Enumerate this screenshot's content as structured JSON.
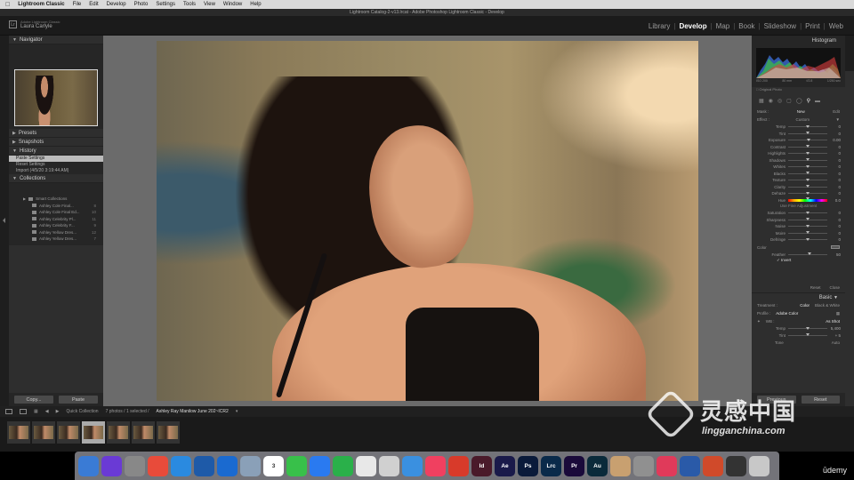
{
  "menubar": {
    "app": "Lightroom Classic",
    "items": [
      "File",
      "Edit",
      "Develop",
      "Photo",
      "Settings",
      "Tools",
      "View",
      "Window",
      "Help"
    ],
    "clock": "Fri 3:06 PM"
  },
  "window_title": "Lightroom Catalog-2-v13.lrcat - Adobe Photoshop Lightroom Classic - Develop",
  "identity": {
    "sub": "Adobe Lightroom Classic",
    "user": "Laura Carlyle"
  },
  "modules": [
    "Library",
    "Develop",
    "Map",
    "Book",
    "Slideshow",
    "Print",
    "Web"
  ],
  "active_module": "Develop",
  "left_panel": {
    "navigator": {
      "label": "Navigator",
      "zoom": [
        "FIT",
        "FILL",
        "1:1",
        "2:1"
      ]
    },
    "presets": "Presets",
    "snapshots": "Snapshots",
    "history": {
      "label": "History",
      "items": [
        "Paste Settings",
        "Reset Settings",
        "Import (4/5/20 3:19:44 AM)"
      ]
    },
    "collections": {
      "label": "Collections",
      "items": [
        {
          "name": "Smart Collections",
          "count": ""
        },
        {
          "name": "Ashley Cole Final...",
          "count": "8"
        },
        {
          "name": "Ashley Cole Final Ed...",
          "count": "10"
        },
        {
          "name": "Ashley Celebrity Pl...",
          "count": "11"
        },
        {
          "name": "Ashley Celebrity F...",
          "count": "9"
        },
        {
          "name": "Ashley Yellow Dres...",
          "count": "12"
        },
        {
          "name": "Ashley Yellow Dres...",
          "count": "7"
        }
      ]
    },
    "copy_btn": "Copy...",
    "paste_btn": "Paste"
  },
  "right_panel": {
    "histogram": "Histogram",
    "hist_info": [
      "ISO 200",
      "80 mm",
      "f/2.8",
      "1/250 sec"
    ],
    "original_photo": "Original Photo",
    "mask_label": "Mask :",
    "mask_new": "New",
    "mask_edit": "Edit",
    "effect": {
      "label": "Effect :",
      "value": "Custom"
    },
    "sliders": [
      {
        "label": "Temp",
        "pos": 0.5,
        "val": "0"
      },
      {
        "label": "Tint",
        "pos": 0.5,
        "val": "0"
      },
      {
        "label": "Exposure",
        "pos": 0.52,
        "val": "0.00"
      },
      {
        "label": "Contrast",
        "pos": 0.5,
        "val": "0"
      },
      {
        "label": "Highlights",
        "pos": 0.5,
        "val": "0"
      },
      {
        "label": "Shadows",
        "pos": 0.5,
        "val": "0"
      },
      {
        "label": "Whites",
        "pos": 0.5,
        "val": "0"
      },
      {
        "label": "Blacks",
        "pos": 0.5,
        "val": "0"
      },
      {
        "label": "Texture",
        "pos": 0.5,
        "val": "0"
      },
      {
        "label": "Clarity",
        "pos": 0.5,
        "val": "0"
      },
      {
        "label": "Dehaze",
        "pos": 0.5,
        "val": "0"
      }
    ],
    "hue": {
      "label": "Hue",
      "pos": 0.5,
      "val": "0.0"
    },
    "hue_sub": "Use Fine Adjustment",
    "sliders2": [
      {
        "label": "Saturation",
        "pos": 0.5,
        "val": "0"
      },
      {
        "label": "Sharpness",
        "pos": 0.5,
        "val": "0"
      },
      {
        "label": "Noise",
        "pos": 0.5,
        "val": "0"
      },
      {
        "label": "Moire",
        "pos": 0.5,
        "val": "0"
      },
      {
        "label": "Defringe",
        "pos": 0.5,
        "val": "0"
      }
    ],
    "color_label": "Color",
    "feather": {
      "label": "Feather",
      "pos": 0.55,
      "val": "50"
    },
    "invert": "Invert",
    "reset": "Reset",
    "close": "Close",
    "basic": "Basic",
    "treatment": {
      "label": "Treatment :",
      "color": "Color",
      "bw": "Black & White"
    },
    "profile": {
      "label": "Profile :",
      "value": "Adobe Color"
    },
    "wb": {
      "label": "WB :",
      "value": "As Shot"
    },
    "sliders3": [
      {
        "label": "Temp",
        "pos": 0.5,
        "val": "5,400"
      },
      {
        "label": "Tint",
        "pos": 0.5,
        "val": "+ 5"
      }
    ],
    "tone_label": "Tone",
    "auto": "Auto",
    "previous_btn": "Previous",
    "reset_btn": "Reset"
  },
  "filmbar": {
    "source": "Quick Collection",
    "info": "7 photos / 1 selected /",
    "file": "Ashley Ray Manilow June 202~ICR2"
  },
  "filmstrip_count": 7,
  "filmstrip_selected": 4,
  "dock": [
    {
      "name": "finder-icon",
      "bg": "#3a7bd5",
      "t": ""
    },
    {
      "name": "siri-icon",
      "bg": "#6a3ad5",
      "t": ""
    },
    {
      "name": "launchpad-icon",
      "bg": "#888888",
      "t": ""
    },
    {
      "name": "chrome-icon",
      "bg": "#e84b3a",
      "t": ""
    },
    {
      "name": "safari-icon",
      "bg": "#2a8ae0",
      "t": ""
    },
    {
      "name": "lookup-icon",
      "bg": "#1e5aa8",
      "t": ""
    },
    {
      "name": "teamviewer-icon",
      "bg": "#1a6ad0",
      "t": ""
    },
    {
      "name": "preview-icon",
      "bg": "#8aa0b8",
      "t": ""
    },
    {
      "name": "calendar-icon",
      "bg": "#ffffff",
      "t": "3"
    },
    {
      "name": "messages-icon",
      "bg": "#38c04a",
      "t": ""
    },
    {
      "name": "zoom-icon",
      "bg": "#2a7af0",
      "t": ""
    },
    {
      "name": "wechat-icon",
      "bg": "#2ab04a",
      "t": ""
    },
    {
      "name": "textedit-icon",
      "bg": "#e8e8e8",
      "t": ""
    },
    {
      "name": "document-icon",
      "bg": "#d0d0d0",
      "t": ""
    },
    {
      "name": "keynote-icon",
      "bg": "#3a90e0",
      "t": ""
    },
    {
      "name": "music-icon",
      "bg": "#f04060",
      "t": ""
    },
    {
      "name": "acrobat-icon",
      "bg": "#d83a2a",
      "t": ""
    },
    {
      "name": "indesign-icon",
      "bg": "#4a1a2a",
      "t": "Id"
    },
    {
      "name": "aftereffects-icon",
      "bg": "#1a1a4a",
      "t": "Ae"
    },
    {
      "name": "photoshop-icon",
      "bg": "#0a1a3a",
      "t": "Ps"
    },
    {
      "name": "lightroom-classic-icon",
      "bg": "#0a2a4a",
      "t": "Lrc"
    },
    {
      "name": "premiere-icon",
      "bg": "#1a0a3a",
      "t": "Pr"
    },
    {
      "name": "audition-icon",
      "bg": "#0a2a3a",
      "t": "Au"
    },
    {
      "name": "notes-icon",
      "bg": "#c8a070",
      "t": ""
    },
    {
      "name": "system-preferences-icon",
      "bg": "#909090",
      "t": ""
    },
    {
      "name": "creative-cloud-icon",
      "bg": "#e03a5a",
      "t": ""
    },
    {
      "name": "word-icon",
      "bg": "#2a5aa8",
      "t": ""
    },
    {
      "name": "powerpoint-icon",
      "bg": "#d04a2a",
      "t": ""
    },
    {
      "name": "screen-icon",
      "bg": "#333333",
      "t": ""
    },
    {
      "name": "trash-icon",
      "bg": "#c8c8c8",
      "t": ""
    }
  ],
  "udemy": "ūdemy",
  "watermark": {
    "cn": "灵感中国",
    "url": "lingganchina.com"
  }
}
